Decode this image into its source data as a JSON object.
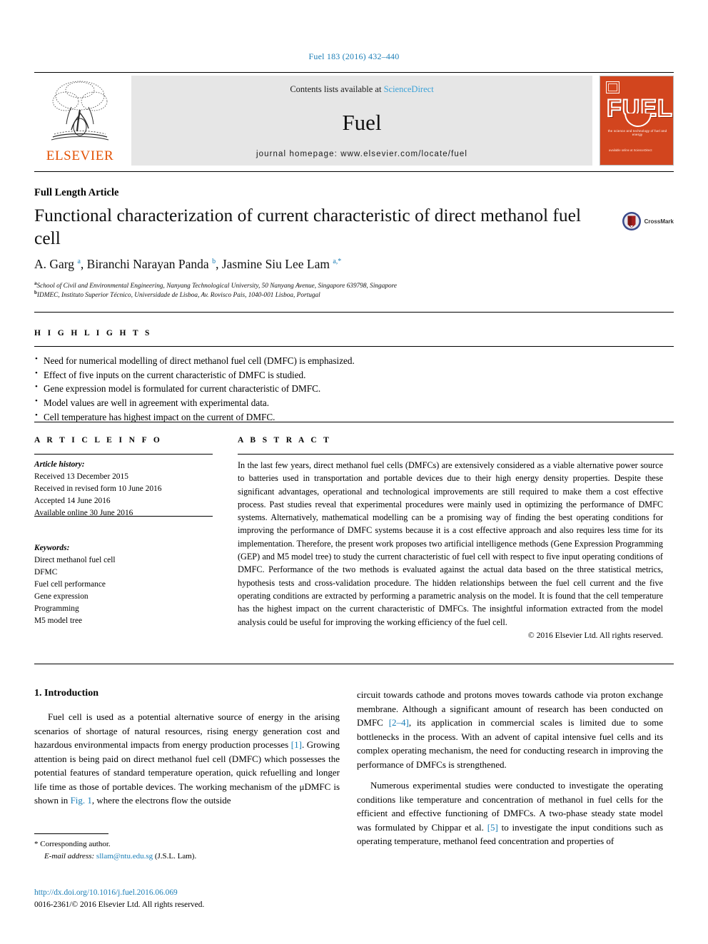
{
  "running_head": "Fuel 183 (2016) 432–440",
  "masthead": {
    "publisher": "ELSEVIER",
    "contents_prefix": "Contents lists available at ",
    "contents_link": "ScienceDirect",
    "journal_name": "Fuel",
    "homepage": "journal homepage: www.elsevier.com/locate/fuel",
    "cover": {
      "title": "FUEL",
      "subtitle": "the science and technology of fuel and energy",
      "footer": "available online at\nScienceDirect"
    },
    "accent_orange": "#e35205",
    "cover_color": "#d2451e",
    "link_blue": "#1a7db6"
  },
  "article": {
    "type": "Full Length Article",
    "title": "Functional characterization of current characteristic of direct methanol fuel cell",
    "crossmark_label": "CrossMark",
    "authors_html": "A. Garg <sup>a</sup>, Biranchi Narayan Panda <sup>b</sup>, Jasmine Siu Lee Lam <sup>a,*</sup>",
    "affiliations": [
      "School of Civil and Environmental Engineering, Nanyang Technological University, 50 Nanyang Avenue, Singapore 639798, Singapore",
      "IDMEC, Instituto Superior Técnico, Universidade de Lisboa, Av. Rovisco Pais, 1040-001 Lisboa, Portugal"
    ],
    "affiliation_marks": [
      "a",
      "b"
    ]
  },
  "highlights": {
    "label": "H I G H L I G H T S",
    "items": [
      "Need for numerical modelling of direct methanol fuel cell (DMFC) is emphasized.",
      "Effect of five inputs on the current characteristic of DMFC is studied.",
      "Gene expression model is formulated for current characteristic of DMFC.",
      "Model values are well in agreement with experimental data.",
      "Cell temperature has highest impact on the current of DMFC."
    ]
  },
  "article_info": {
    "label": "A R T I C L E  I N F O",
    "history_heading": "Article history:",
    "history": [
      "Received 13 December 2015",
      "Received in revised form 10 June 2016",
      "Accepted 14 June 2016",
      "Available online 30 June 2016"
    ],
    "keywords_heading": "Keywords:",
    "keywords": [
      "Direct methanol fuel cell",
      "DFMC",
      "Fuel cell performance",
      "Gene expression",
      "Programming",
      "M5 model tree"
    ]
  },
  "abstract": {
    "label": "A B S T R A C T",
    "text": "In the last few years, direct methanol fuel cells (DMFCs) are extensively considered as a viable alternative power source to batteries used in transportation and portable devices due to their high energy density properties. Despite these significant advantages, operational and technological improvements are still required to make them a cost effective process. Past studies reveal that experimental procedures were mainly used in optimizing the performance of DMFC systems. Alternatively, mathematical modelling can be a promising way of finding the best operating conditions for improving the performance of DMFC systems because it is a cost effective approach and also requires less time for its implementation. Therefore, the present work proposes two artificial intelligence methods (Gene Expression Programming (GEP) and M5 model tree) to study the current characteristic of fuel cell with respect to five input operating conditions of DMFC. Performance of the two methods is evaluated against the actual data based on the three statistical metrics, hypothesis tests and cross-validation procedure. The hidden relationships between the fuel cell current and the five operating conditions are extracted by performing a parametric analysis on the model. It is found that the cell temperature has the highest impact on the current characteristic of DMFCs. The insightful information extracted from the model analysis could be useful for improving the working efficiency of the fuel cell.",
    "copyright": "© 2016 Elsevier Ltd. All rights reserved."
  },
  "body": {
    "section_title": "1. Introduction",
    "left_paragraph_1": "Fuel cell is used as a potential alternative source of energy in the arising scenarios of shortage of natural resources, rising energy generation cost and hazardous environmental impacts from energy production processes ",
    "left_ref_1": "[1]",
    "left_paragraph_1b": ". Growing attention is being paid on direct methanol fuel cell (DMFC) which possesses the potential features of standard temperature operation, quick refuelling and longer life time as those of portable devices. The working mechanism of the μDMFC is shown in ",
    "left_ref_fig": "Fig. 1",
    "left_paragraph_1c": ", where the electrons flow the outside",
    "right_paragraph_1": "circuit towards cathode and protons moves towards cathode via proton exchange membrane. Although a significant amount of research has been conducted on DMFC ",
    "right_ref_1": "[2–4]",
    "right_paragraph_1b": ", its application in commercial scales is limited due to some bottlenecks in the process. With an advent of capital intensive fuel cells and its complex operating mechanism, the need for conducting research in improving the performance of DMFCs is strengthened.",
    "right_paragraph_2": "Numerous experimental studies were conducted to investigate the operating conditions like temperature and concentration of methanol in fuel cells for the efficient and effective functioning of DMFCs. A two-phase steady state model was formulated by Chippar et al. ",
    "right_ref_2": "[5]",
    "right_paragraph_2b": " to investigate the input conditions such as operating temperature, methanol feed concentration and properties of"
  },
  "footer": {
    "corresponding_marker": "*",
    "corresponding_text": "Corresponding author.",
    "email_label": "E-mail address:",
    "email": "sllam@ntu.edu.sg",
    "email_suffix": "(J.S.L. Lam).",
    "doi": "http://dx.doi.org/10.1016/j.fuel.2016.06.069",
    "issn_line": "0016-2361/© 2016 Elsevier Ltd. All rights reserved."
  }
}
